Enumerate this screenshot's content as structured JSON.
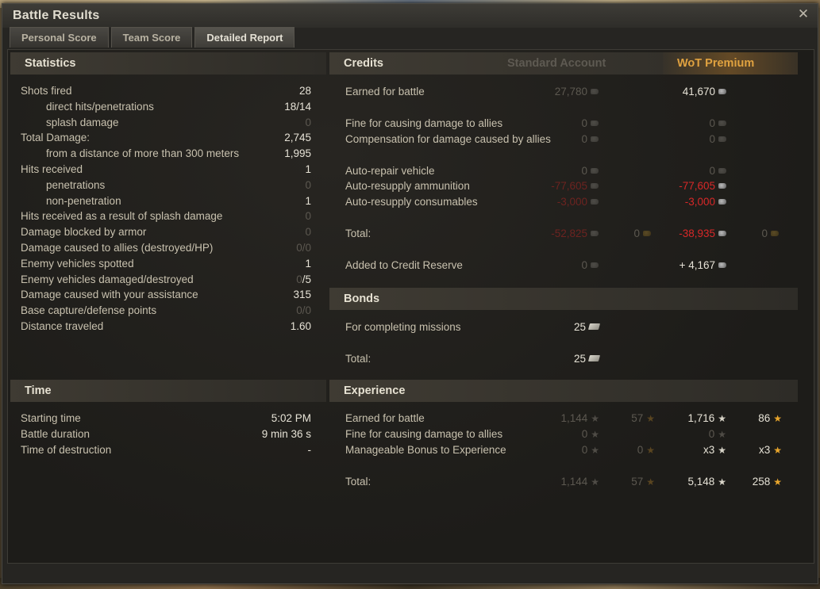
{
  "window": {
    "title": "Battle Results",
    "close_glyph": "✕"
  },
  "tabs": [
    {
      "label": "Personal Score",
      "active": false
    },
    {
      "label": "Team Score",
      "active": false
    },
    {
      "label": "Detailed Report",
      "active": true
    }
  ],
  "statistics": {
    "title": "Statistics",
    "rows": [
      {
        "label": "Shots fired",
        "value": "28"
      },
      {
        "label": "direct hits/penetrations",
        "value": "18/14"
      },
      {
        "label": "splash damage",
        "value": "0"
      },
      {
        "label": "Total Damage:",
        "value": "2,745"
      },
      {
        "label": "from a distance of more than 300 meters",
        "value": "1,995"
      },
      {
        "label": "Hits received",
        "value": "1"
      },
      {
        "label": "penetrations",
        "value": "0"
      },
      {
        "label": "non-penetration",
        "value": "1"
      },
      {
        "label": "Hits received as a result of splash damage",
        "value": "0"
      },
      {
        "label": "Damage blocked by armor",
        "value": "0"
      },
      {
        "label": "Damage caused to allies (destroyed/HP)",
        "value": "0/0"
      },
      {
        "label": "Enemy vehicles spotted",
        "value": "1"
      },
      {
        "label": "Enemy vehicles damaged/destroyed",
        "value_a": "0",
        "value_b": "/5"
      },
      {
        "label": "Damage caused with your assistance",
        "value": "315"
      },
      {
        "label": "Base capture/defense points",
        "value": "0/0"
      },
      {
        "label": "Distance traveled",
        "value": "1.60"
      }
    ]
  },
  "time": {
    "title": "Time",
    "rows": [
      {
        "label": "Starting time",
        "value": "5:02 PM"
      },
      {
        "label": "Battle duration",
        "value": "9 min 36 s"
      },
      {
        "label": "Time of destruction",
        "value": "-"
      }
    ]
  },
  "credits": {
    "title": "Credits",
    "standard_label": "Standard Account",
    "premium_label": "WoT Premium",
    "rows": [
      {
        "label": "Earned for battle",
        "std": "27,780",
        "prem": "41,670"
      },
      {
        "label": "Fine for causing damage to allies",
        "std": "0",
        "prem": "0"
      },
      {
        "label": "Compensation for damage caused by allies",
        "std": "0",
        "prem": "0"
      },
      {
        "label": "Auto-repair vehicle",
        "std": "0",
        "prem": "0"
      },
      {
        "label": "Auto-resupply ammunition",
        "std": "-77,605",
        "prem": "-77,605"
      },
      {
        "label": "Auto-resupply consumables",
        "std": "-3,000",
        "prem": "-3,000"
      },
      {
        "label": "Total:",
        "std": "-52,825",
        "std_gold": "0",
        "prem": "-38,935",
        "prem_gold": "0"
      },
      {
        "label": "Added to Credit Reserve",
        "std": "0",
        "prem": "+ 4,167"
      }
    ]
  },
  "bonds": {
    "title": "Bonds",
    "rows": [
      {
        "label": "For completing missions",
        "value": "25"
      },
      {
        "label": "Total:",
        "value": "25"
      }
    ]
  },
  "experience": {
    "title": "Experience",
    "rows": [
      {
        "label": "Earned for battle",
        "std_xp": "1,144",
        "std_free": "57",
        "prem_xp": "1,716",
        "prem_free": "86"
      },
      {
        "label": "Fine for causing damage to allies",
        "std_xp": "0",
        "prem_xp": "0"
      },
      {
        "label": "Manageable Bonus to Experience",
        "std_xp": "0",
        "std_free": "0",
        "prem_xp": "x3",
        "prem_free": "x3"
      },
      {
        "label": "Total:",
        "std_xp": "1,144",
        "std_free": "57",
        "prem_xp": "5,148",
        "prem_free": "258"
      }
    ]
  }
}
